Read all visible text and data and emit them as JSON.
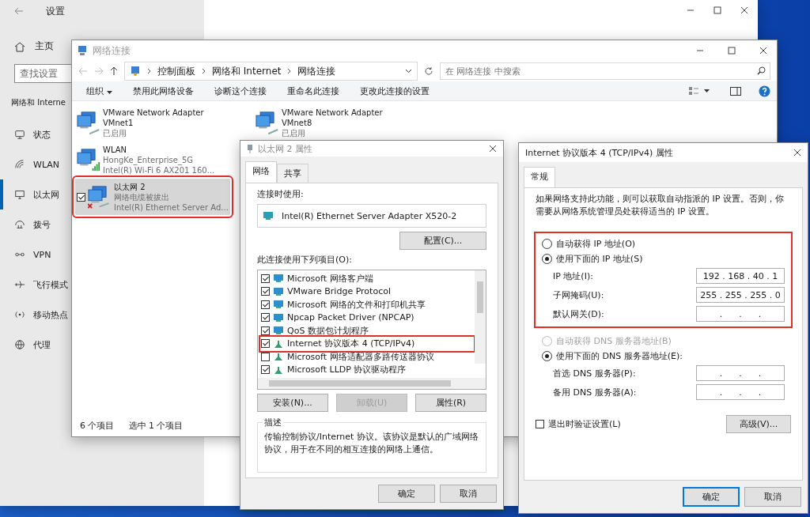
{
  "settings": {
    "title": "设置",
    "home": "主页",
    "search": {
      "placeholder": "查找设置"
    },
    "section": "网络和 Interne",
    "nav": [
      {
        "label": "状态",
        "selected": false
      },
      {
        "label": "WLAN",
        "selected": false
      },
      {
        "label": "以太网",
        "selected": true
      },
      {
        "label": "拨号",
        "selected": false
      },
      {
        "label": "VPN",
        "selected": false
      },
      {
        "label": "飞行模式",
        "selected": false
      },
      {
        "label": "移动热点",
        "selected": false
      },
      {
        "label": "代理",
        "selected": false
      }
    ]
  },
  "network_connections": {
    "title": "网络连接",
    "breadcrumb": [
      "控制面板",
      "网络和 Internet",
      "网络连接"
    ],
    "search": {
      "placeholder": "在 网络连接 中搜索"
    },
    "toolbar": [
      {
        "label": "组织",
        "kind": "menu"
      },
      {
        "label": "禁用此网络设备",
        "kind": "action"
      },
      {
        "label": "诊断这个连接",
        "kind": "action"
      },
      {
        "label": "重命名此连接",
        "kind": "action"
      },
      {
        "label": "更改此连接的设置",
        "kind": "action"
      }
    ],
    "adapters": [
      {
        "name": "VMware Network Adapter VMnet1",
        "status": "已启用",
        "kind": "wired",
        "selected": false,
        "checked": false
      },
      {
        "name": "WLAN",
        "status": "HongKe_Enterprise_5G",
        "device": "Intel(R) Wi-Fi 6 AX201 160...",
        "kind": "wifi",
        "selected": false,
        "checked": false
      },
      {
        "name": "以太网 2",
        "status": "网络电缆被拔出",
        "device": "Intel(R) Ethernet Server Ad...",
        "kind": "disconnected",
        "selected": true,
        "checked": true,
        "highlighted": true
      },
      {
        "name": "VMware Network Adapter VMnet8",
        "status": "已启用",
        "kind": "wired",
        "selected": false,
        "checked": false
      }
    ],
    "status_bar": [
      "6 个项目",
      "选中 1 个项目"
    ]
  },
  "adapter_properties": {
    "title": "以太网 2 属性",
    "tabs": [
      {
        "label": "网络",
        "selected": true
      },
      {
        "label": "共享",
        "selected": false
      }
    ],
    "connect_using_label": "连接时使用:",
    "adapter": "Intel(R) Ethernet Server Adapter X520-2",
    "configure_button": "配置(C)...",
    "items_label": "此连接使用下列项目(O):",
    "items": [
      {
        "label": "Microsoft 网络客户端",
        "kind": "client",
        "checked": true
      },
      {
        "label": "VMware Bridge Protocol",
        "kind": "client",
        "checked": true
      },
      {
        "label": "Microsoft 网络的文件和打印机共享",
        "kind": "client",
        "checked": true
      },
      {
        "label": "Npcap Packet Driver (NPCAP)",
        "kind": "client",
        "checked": true
      },
      {
        "label": "QoS 数据包计划程序",
        "kind": "client",
        "checked": true
      },
      {
        "label": "Internet 协议版本 4 (TCP/IPv4)",
        "kind": "protocol",
        "checked": true,
        "highlighted": true
      },
      {
        "label": "Microsoft 网络适配器多路传送器协议",
        "kind": "protocol",
        "checked": false
      },
      {
        "label": "Microsoft LLDP 协议驱动程序",
        "kind": "protocol",
        "checked": true
      }
    ],
    "buttons": [
      {
        "label": "安装(N)...",
        "disabled": false
      },
      {
        "label": "卸载(U)",
        "disabled": true
      },
      {
        "label": "属性(R)",
        "disabled": false
      }
    ],
    "description_label": "描述",
    "description": "传输控制协议/Internet 协议。该协议是默认的广域网络协议，用于在不同的相互连接的网络上通信。",
    "footer_buttons": [
      {
        "label": "确定",
        "default": false
      },
      {
        "label": "取消",
        "default": false
      }
    ]
  },
  "ipv4_properties": {
    "title": "Internet 协议版本 4 (TCP/IPv4) 属性",
    "tabs": [
      {
        "label": "常规",
        "selected": true
      }
    ],
    "intro": "如果网络支持此功能，则可以获取自动指派的 IP 设置。否则，你需要从网络系统管理员处获得适当的 IP 设置。",
    "ip_highlighted": true,
    "ip_modes": [
      {
        "label": "自动获得 IP 地址(O)",
        "selected": false,
        "disabled": false
      },
      {
        "label": "使用下面的 IP 地址(S)",
        "selected": true,
        "disabled": false
      }
    ],
    "ip_fields": [
      {
        "label": "IP 地址(I):",
        "value": "192 . 168 . 40 . 1"
      },
      {
        "label": "子网掩码(U):",
        "value": "255 . 255 . 255 . 0"
      },
      {
        "label": "默认网关(D):",
        "value": ".      .      ."
      }
    ],
    "dns_modes": [
      {
        "label": "自动获得 DNS 服务器地址(B)",
        "selected": false,
        "disabled": true
      },
      {
        "label": "使用下面的 DNS 服务器地址(E):",
        "selected": true,
        "disabled": false
      }
    ],
    "dns_fields": [
      {
        "label": "首选 DNS 服务器(P):",
        "value": ".      .      ."
      },
      {
        "label": "备用 DNS 服务器(A):",
        "value": ".      .      ."
      }
    ],
    "validate": {
      "label": "退出时验证设置(L)",
      "checked": false
    },
    "advanced_button": "高级(V)...",
    "footer_buttons": [
      {
        "label": "确定",
        "default": true
      },
      {
        "label": "取消",
        "default": false
      }
    ]
  }
}
